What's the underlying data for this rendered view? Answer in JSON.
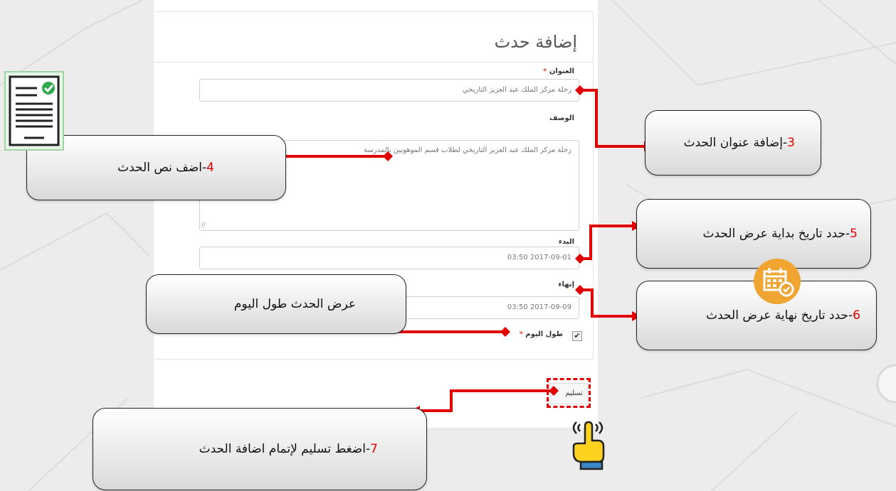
{
  "form": {
    "title": "إضافة حدث",
    "title_label": "العنوان",
    "required_mark": "*",
    "title_value": "رحلة مركز الملك عبد العزيز التاريخي",
    "description_label": "الوصف",
    "description_value": "رحلة مركز الملك عبد العزيز التاريخي لطلاب قسم الموهوبين بالمدرسة",
    "start_label": "البدء",
    "start_value": "2017-09-01 03:50",
    "end_label": "إنهاء",
    "end_value": "2017-09-09 03:50",
    "all_day_label": "طول اليوم",
    "all_day_checked": true,
    "submit_label": "تسليم"
  },
  "callouts": {
    "c3": {
      "num": "3",
      "text": "-إضافة عنوان الحدث"
    },
    "c4": {
      "num": "4",
      "text": "-اضف نص الحدث"
    },
    "c5": {
      "num": "5",
      "text": "-حدد تاريخ بداية عرض الحدث"
    },
    "c6": {
      "num": "6",
      "text": "-حدد تاريخ نهاية عرض الحدث"
    },
    "c_allday": {
      "text": "عرض الحدث طول اليوم"
    },
    "c7": {
      "num": "7",
      "text": "-اضغط تسليم لإتمام اضافة الحدث"
    }
  },
  "icons": {
    "document": "document-check-icon",
    "calendar": "calendar-check-icon",
    "hand": "pointing-hand-icon"
  },
  "colors": {
    "accent_red": "#e00000",
    "callout_border": "#222222",
    "badge_orange": "#f0a432"
  }
}
